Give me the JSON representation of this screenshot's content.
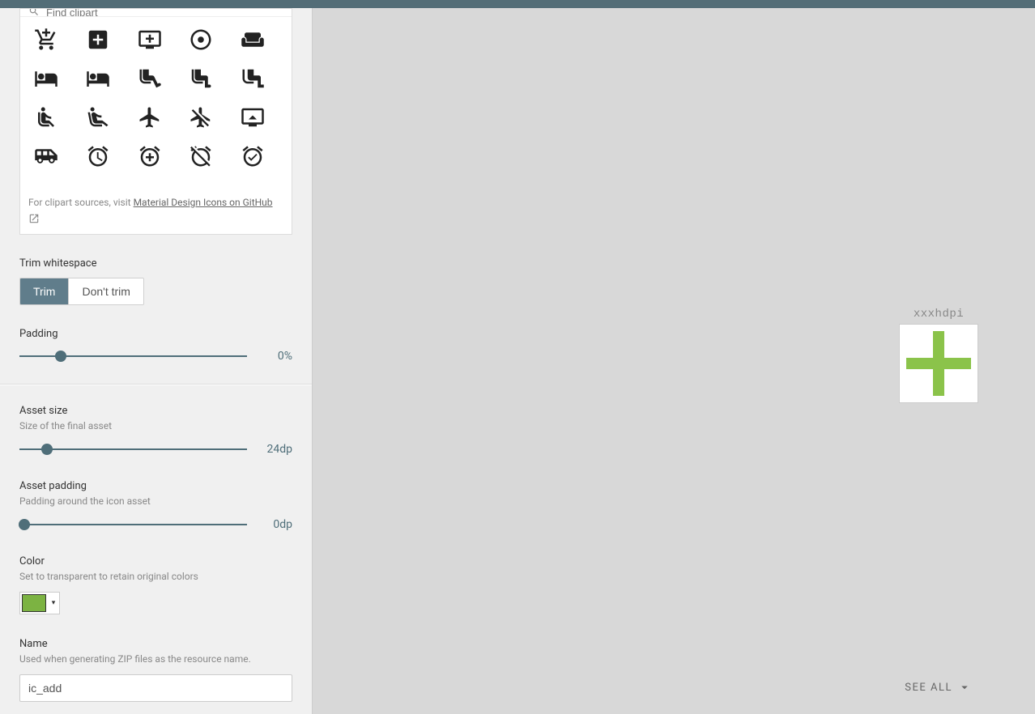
{
  "sidebar": {
    "clipart": {
      "search_placeholder": "Find clipart",
      "footer_prefix": "For clipart sources, visit ",
      "footer_link": "Material Design Icons on GitHub",
      "icons": [
        "add-shopping-cart-icon",
        "add-box-icon",
        "add-to-queue-icon",
        "adjust-icon",
        "weekend-icon",
        "hotel-icon",
        "local-hotel-icon",
        "seat-icon",
        "seat-legroom-icon",
        "seat-legroom-extra-icon",
        "seat-recline-normal-icon",
        "seat-recline-extra-icon",
        "airplane-icon",
        "airplane-off-icon",
        "cast-icon",
        "airport-shuttle-icon",
        "alarm-icon",
        "alarm-add-icon",
        "alarm-off-icon",
        "alarm-on-icon"
      ]
    },
    "trim": {
      "label": "Trim whitespace",
      "option_trim": "Trim",
      "option_dont": "Don't trim"
    },
    "padding": {
      "label": "Padding",
      "value": "0%",
      "percent": 18
    },
    "asset_size": {
      "label": "Asset size",
      "sub": "Size of the final asset",
      "value": "24dp",
      "percent": 12
    },
    "asset_padding": {
      "label": "Asset padding",
      "sub": "Padding around the icon asset",
      "value": "0dp",
      "percent": 2
    },
    "color": {
      "label": "Color",
      "sub": "Set to transparent to retain original colors",
      "hex": "#7cb342"
    },
    "name": {
      "label": "Name",
      "sub": "Used when generating ZIP files as the resource name.",
      "value": "ic_add"
    }
  },
  "preview": {
    "density_label": "xxxhdpi",
    "see_all": "SEE ALL"
  }
}
